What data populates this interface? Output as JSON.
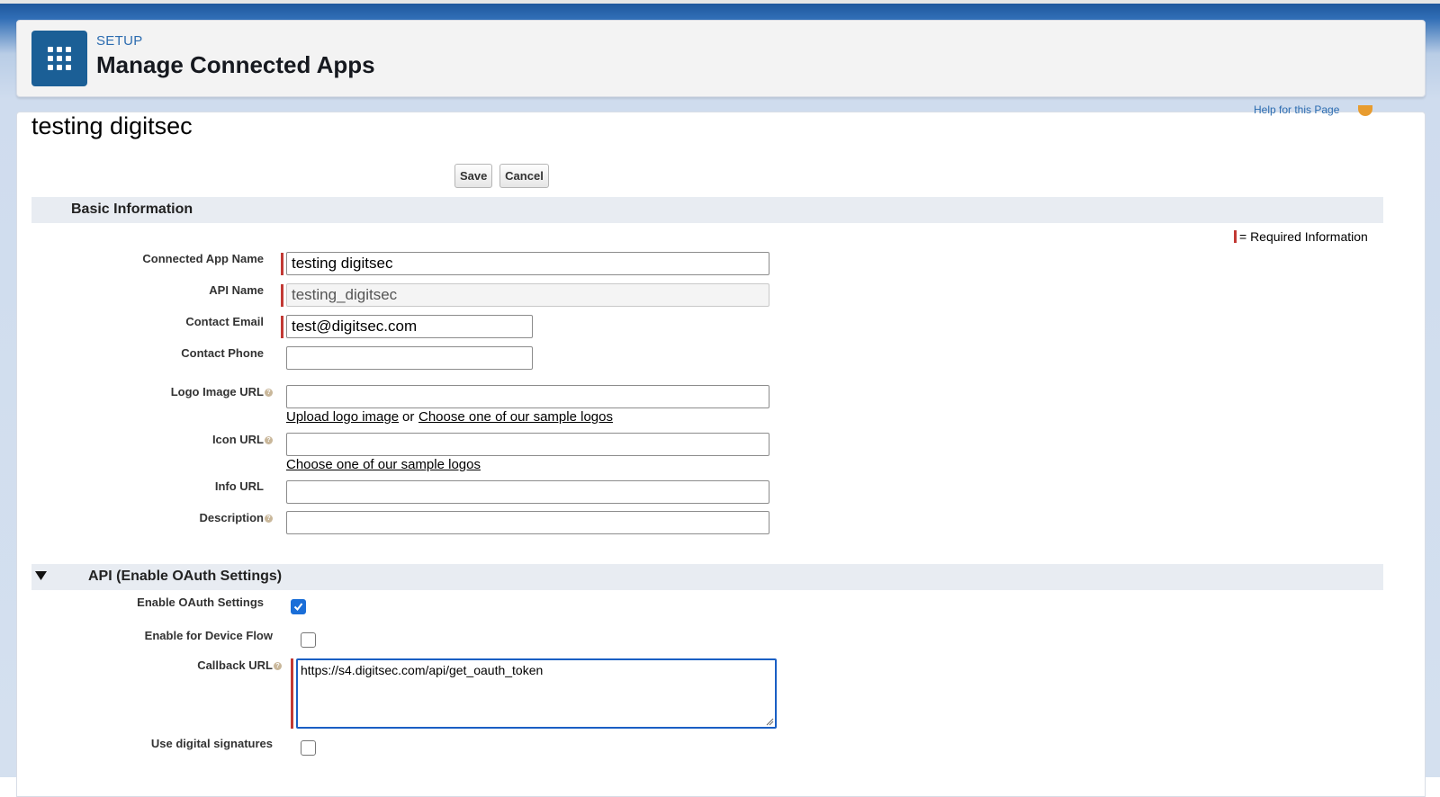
{
  "header": {
    "breadcrumb": "SETUP",
    "title": "Manage Connected Apps",
    "app_icon": "app-launcher-grid-icon"
  },
  "record": {
    "title": "testing digitsec",
    "help_link": "Help for this Page"
  },
  "toolbar": {
    "save_label": "Save",
    "cancel_label": "Cancel"
  },
  "basic_info": {
    "section_title": "Basic Information",
    "required_legend": "= Required Information",
    "connected_app_name_label": "Connected App Name",
    "connected_app_name_value": "testing digitsec",
    "api_name_label": "API Name",
    "api_name_value": "testing_digitsec",
    "contact_email_label": "Contact Email",
    "contact_email_value": "test@digitsec.com",
    "contact_phone_label": "Contact Phone",
    "contact_phone_value": "",
    "logo_image_url_label": "Logo Image URL",
    "logo_image_url_value": "",
    "upload_logo_link": "Upload logo image",
    "or_text": "or",
    "choose_sample_logos_link": "Choose one of our sample logos",
    "icon_url_label": "Icon URL",
    "icon_url_value": "",
    "icon_choose_sample_logos_link": "Choose one of our sample logos",
    "info_url_label": "Info URL",
    "info_url_value": "",
    "description_label": "Description",
    "description_value": ""
  },
  "api_section": {
    "section_title": "API (Enable OAuth Settings)",
    "enable_oauth_label": "Enable OAuth Settings",
    "enable_oauth_checked": true,
    "device_flow_label": "Enable for Device Flow",
    "device_flow_checked": false,
    "callback_url_label": "Callback URL",
    "callback_url_value": "https://s4.digitsec.com/api/get_oauth_token",
    "digital_signatures_label": "Use digital signatures",
    "digital_signatures_checked": false
  },
  "colors": {
    "required": "#c23934",
    "brand_blue": "#1b5f96",
    "link_blue": "#2c6cb0",
    "checkbox_blue": "#1a6ed8"
  }
}
